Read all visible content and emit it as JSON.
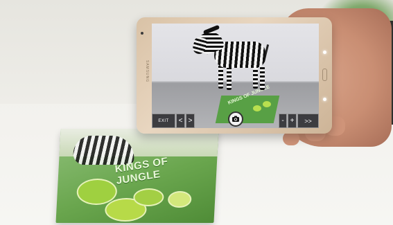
{
  "tablet": {
    "brand": "SAMSUNG"
  },
  "screen": {
    "book_title": "KINGS OF JUNGLE"
  },
  "toolbar": {
    "exit_label": "EXIT",
    "prev_label": "<",
    "next_label": ">",
    "camera_icon": "camera-icon",
    "minus_label": "-",
    "plus_label": "+",
    "forward_label": ">>"
  },
  "magazine": {
    "title": "KINGS OF JUNGLE"
  }
}
